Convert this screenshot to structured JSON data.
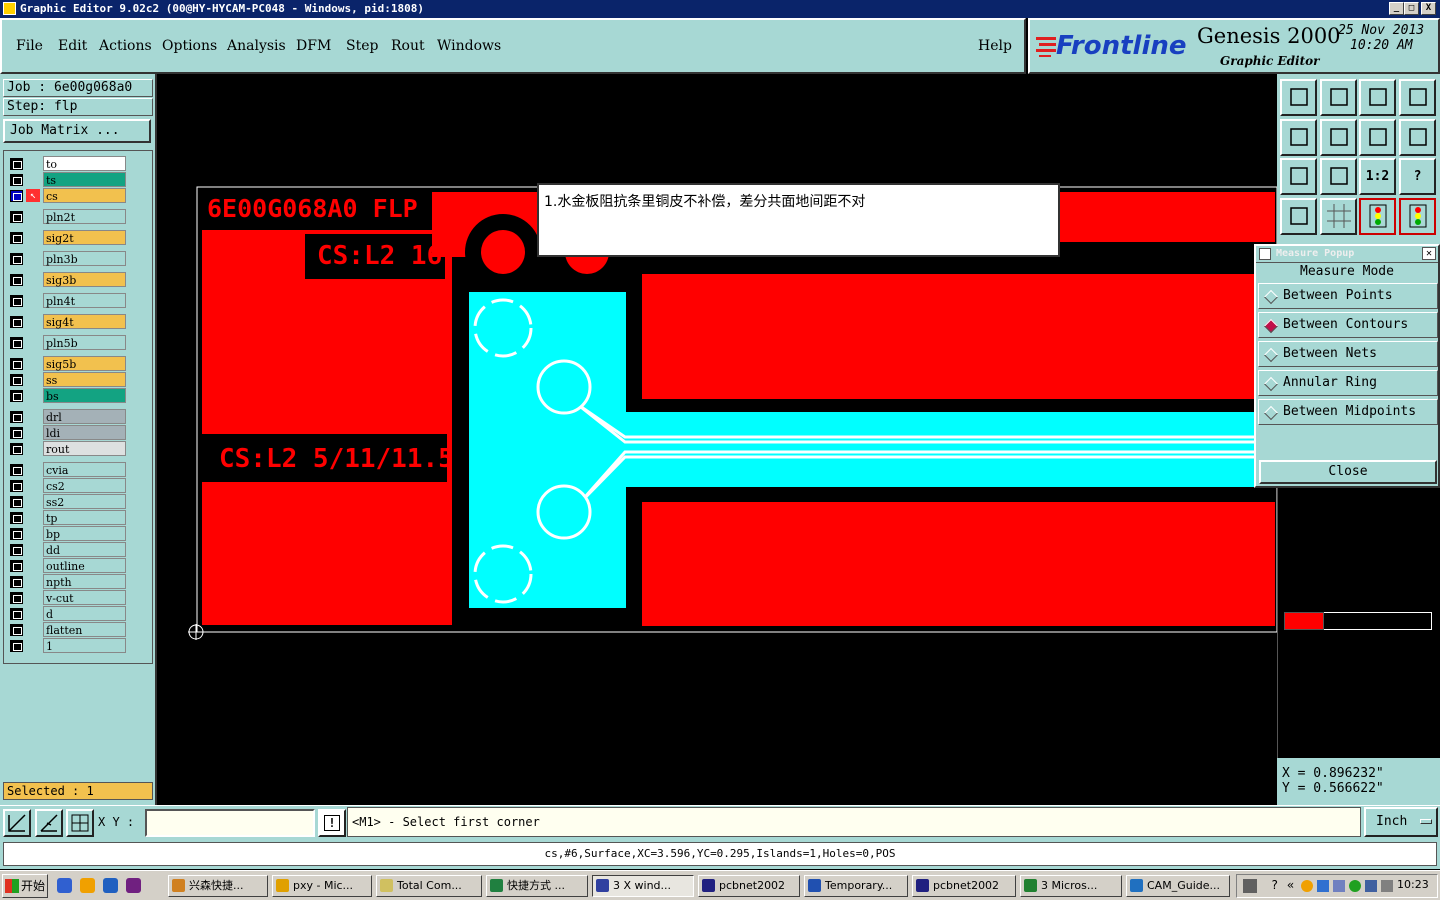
{
  "window": {
    "title": "Graphic Editor 9.02c2  (00@HY-HYCAM-PC048 - Windows, pid:1808)",
    "controls": [
      "_",
      "□",
      "X"
    ]
  },
  "menu": [
    "File",
    "Edit",
    "Actions",
    "Options",
    "Analysis",
    "DFM",
    "Step",
    "Rout",
    "Windows"
  ],
  "help_label": "Help",
  "brand": {
    "logo": "Frontline",
    "product": "Genesis 2000",
    "subtitle": "Graphic Editor",
    "date": "25 Nov 2013",
    "time": "10:20 AM"
  },
  "job": {
    "job_line": "Job : 6e00g068a0",
    "step_line": "Step: flp",
    "job_matrix": "Job Matrix ..."
  },
  "layers": [
    {
      "name": "to",
      "color": "#ffffff"
    },
    {
      "name": "ts",
      "color": "#13a382"
    },
    {
      "name": "cs",
      "color": "#f2c14e",
      "active": true
    },
    {
      "name": "pln2t",
      "color": "#a7d8d4"
    },
    {
      "name": "sig2t",
      "color": "#f2c14e"
    },
    {
      "name": "pln3b",
      "color": "#a7d8d4"
    },
    {
      "name": "sig3b",
      "color": "#f2c14e"
    },
    {
      "name": "pln4t",
      "color": "#a7d8d4"
    },
    {
      "name": "sig4t",
      "color": "#f2c14e"
    },
    {
      "name": "pln5b",
      "color": "#a7d8d4"
    },
    {
      "name": "sig5b",
      "color": "#f2c14e"
    },
    {
      "name": "ss",
      "color": "#f2c14e"
    },
    {
      "name": "bs",
      "color": "#13a382"
    },
    {
      "name": "drl",
      "color": "#a4b1b7"
    },
    {
      "name": "ldi",
      "color": "#a4b1b7"
    },
    {
      "name": "rout",
      "color": "#dde0e0"
    },
    {
      "name": "cvia",
      "color": "#a7d8d4"
    },
    {
      "name": "cs2",
      "color": "#a7d8d4"
    },
    {
      "name": "ss2",
      "color": "#a7d8d4"
    },
    {
      "name": "tp",
      "color": "#a7d8d4"
    },
    {
      "name": "bp",
      "color": "#a7d8d4"
    },
    {
      "name": "dd",
      "color": "#a7d8d4"
    },
    {
      "name": "outline",
      "color": "#a7d8d4"
    },
    {
      "name": "npth",
      "color": "#a7d8d4"
    },
    {
      "name": "v-cut",
      "color": "#a7d8d4"
    },
    {
      "name": "d",
      "color": "#a7d8d4"
    },
    {
      "name": "flatten",
      "color": "#a7d8d4"
    },
    {
      "name": "1",
      "color": "#a7d8d4"
    }
  ],
  "selected": "Selected : 1",
  "canvas": {
    "text_flp": "6E00G068A0 FLP",
    "text_cs16": "CS:L2 16",
    "text_cs5": "CS:L2 5/11/11.5",
    "note": "1.水金板阻抗条里铜皮不补偿，差分共面地间距不对",
    "colors": {
      "copper": "#ff0000",
      "selection": "#00ffff"
    }
  },
  "toolbar_icons": [
    "zoom-home-icon",
    "zoom-in-icon",
    "home-icon",
    "window-split-icon",
    "pan-left-icon",
    "pan-right-icon",
    "mirror-icon",
    "snap-icon",
    "fit-icon",
    "center-icon",
    "scale-one-to-two-icon",
    "help-icon",
    "tools-icon",
    "grid-icon",
    "layers-icon",
    "layers-active-icon"
  ],
  "toolbar_scale_label": "1:2",
  "toolbar_help_label": "?",
  "measure": {
    "title": "Measure Popup",
    "mode_label": "Measure Mode",
    "options": [
      "Between Points",
      "Between Contours",
      "Between Nets",
      "Annular Ring",
      "Between Midpoints"
    ],
    "selected": "Between Contours",
    "close": "Close"
  },
  "coords": {
    "x": "X = 0.896232\"",
    "y": "Y = 0.566622\""
  },
  "input": {
    "xy_label": "X Y :",
    "value": "",
    "prompt": "<M1> - Select first corner",
    "unit": "Inch"
  },
  "status": "cs,#6,Surface,XC=3.596,YC=0.295,Islands=1,Holes=0,POS",
  "taskbar": {
    "start": "开始",
    "tasks": [
      {
        "label": "兴森快捷...",
        "icon_color": "#d08020"
      },
      {
        "label": "pxy - Mic...",
        "icon_color": "#e0a000"
      },
      {
        "label": "Total Com...",
        "icon_color": "#d0c060"
      },
      {
        "label": "快捷方式 ...",
        "icon_color": "#208040"
      },
      {
        "label": "3 X wind...",
        "icon_color": "#3040a0",
        "active": true
      },
      {
        "label": "pcbnet2002",
        "icon_color": "#202080"
      },
      {
        "label": "Temporary...",
        "icon_color": "#2050b0"
      },
      {
        "label": "pcbnet2002",
        "icon_color": "#202080"
      },
      {
        "label": "3 Micros...",
        "icon_color": "#208030"
      },
      {
        "label": "CAM_Guide...",
        "icon_color": "#2070c0"
      }
    ],
    "clock": "10:23"
  }
}
